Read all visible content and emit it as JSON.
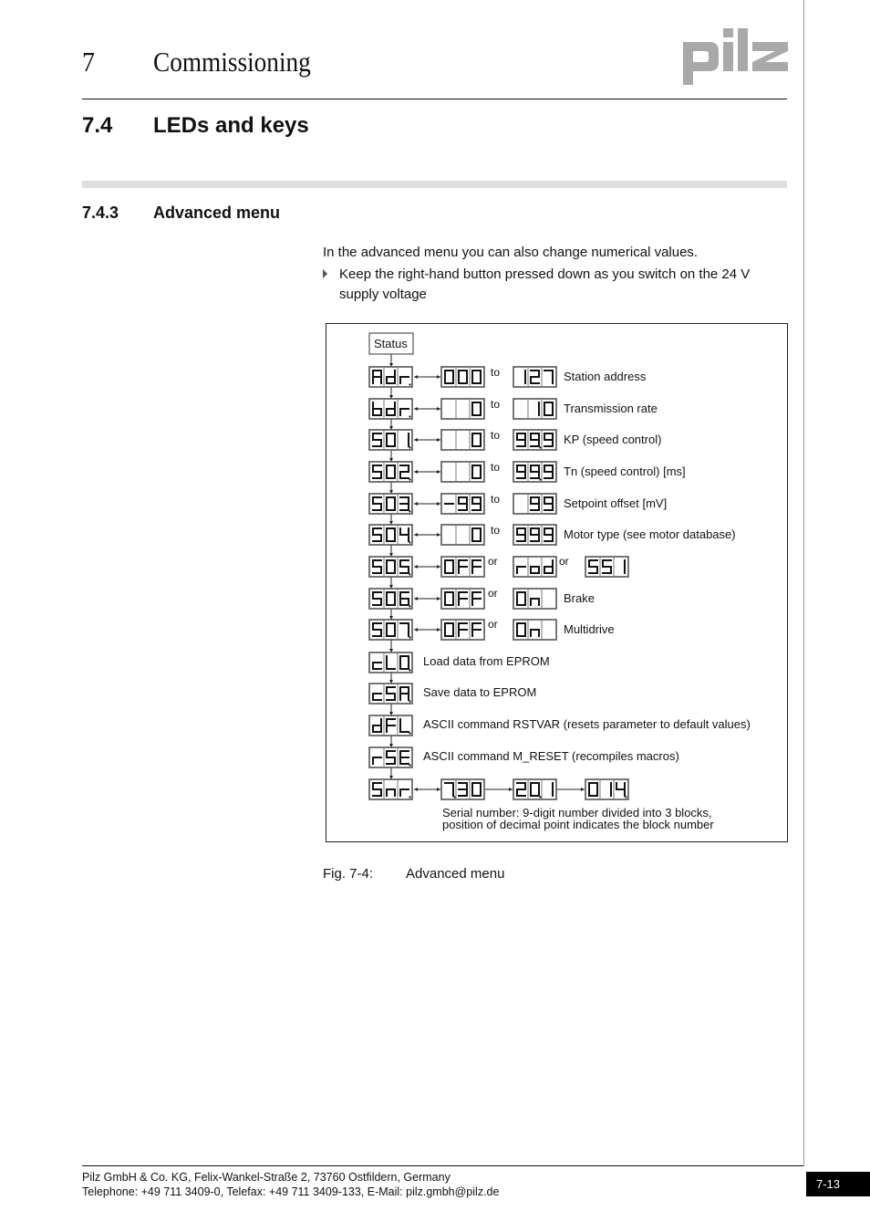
{
  "header": {
    "chapter_number": "7",
    "chapter_title": "Commissioning",
    "logo_text": "pilz"
  },
  "section": {
    "number": "7.4",
    "title": "LEDs and keys"
  },
  "subsection": {
    "number": "7.4.3",
    "title": "Advanced menu"
  },
  "body": {
    "intro": "In the advanced menu you can also change numerical values.",
    "bullet": "Keep the right-hand button pressed down as you switch on the 24 V supply voltage"
  },
  "figure": {
    "status_label": "Status",
    "rows": [
      {
        "code": "Adr.",
        "values": [
          "000",
          "127"
        ],
        "connector": "to",
        "description": "Station address"
      },
      {
        "code": "bdr.",
        "values": [
          "  0",
          " 10"
        ],
        "connector": "to",
        "description": "Transmission rate"
      },
      {
        "code": "S01.",
        "values": [
          "  0",
          "99.9"
        ],
        "connector": "to",
        "description": "KP (speed control)"
      },
      {
        "code": "S02.",
        "values": [
          "  0",
          "99.9"
        ],
        "connector": "to",
        "description": "Tn (speed control) [ms]"
      },
      {
        "code": "S03.",
        "values": [
          "-99",
          " 99"
        ],
        "connector": "to",
        "description": "Setpoint offset [mV]"
      },
      {
        "code": "S04.",
        "values": [
          "  0",
          "999"
        ],
        "connector": "to",
        "description": "Motor type (see motor database)"
      },
      {
        "code": "S05.",
        "values": [
          "OFF",
          "rod",
          "SS1"
        ],
        "connector": "or",
        "description": ""
      },
      {
        "code": "S06.",
        "values": [
          "OFF",
          "On "
        ],
        "connector": "or",
        "description": "Brake"
      },
      {
        "code": "S07.",
        "values": [
          "OFF",
          "On "
        ],
        "connector": "or",
        "description": "Multidrive"
      },
      {
        "code": "cL0.",
        "values": [],
        "connector": "",
        "description": "Load data from EPROM"
      },
      {
        "code": "cSA.",
        "values": [],
        "connector": "",
        "description": "Save data to EPROM"
      },
      {
        "code": "dFL.",
        "values": [],
        "connector": "",
        "description": "ASCII command RSTVAR (resets parameter to default values)"
      },
      {
        "code": "rSE.",
        "values": [],
        "connector": "",
        "description": "ASCII command M_RESET (recompiles macros)"
      },
      {
        "code": "Snr.",
        "values": [
          "7.30",
          "20.1",
          "014."
        ],
        "connector": "",
        "description": ""
      }
    ],
    "serial_note_line1": "Serial number: 9-digit number divided into 3 blocks,",
    "serial_note_line2": "position of decimal point indicates the block number",
    "caption_label": "Fig. 7-4:",
    "caption_text": "Advanced menu"
  },
  "footer": {
    "line1": "Pilz GmbH & Co. KG, Felix-Wankel-Straße 2, 73760 Ostfildern, Germany",
    "line2": "Telephone: +49 711 3409-0, Telefax: +49 711 3409-133, E-Mail: pilz.gmbh@pilz.de",
    "page_number": "7-13"
  },
  "colors": {
    "logo": "#a9a9a9",
    "divider_bar": "#dedede",
    "page_badge": "#000000"
  }
}
